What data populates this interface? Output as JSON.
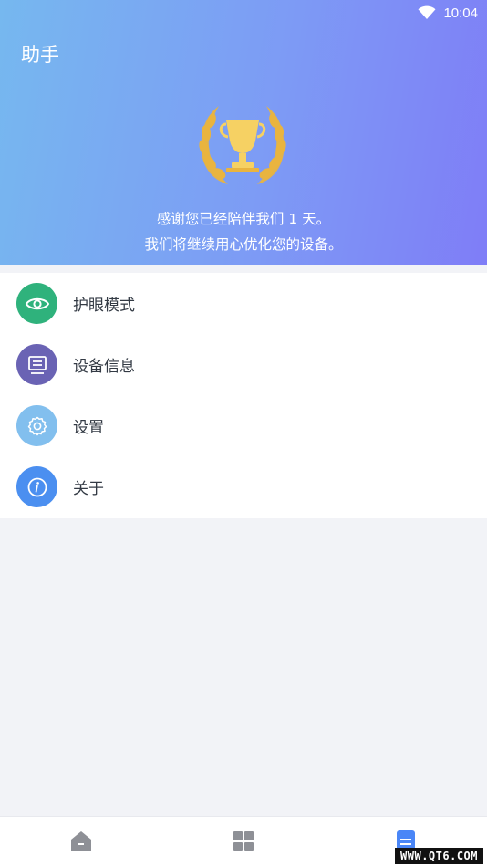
{
  "status_bar": {
    "time": "10:04",
    "wifi_icon": "wifi-icon"
  },
  "header": {
    "title": "助手",
    "trophy_icon": "trophy-laurel-icon",
    "message_line1": "感谢您已经陪伴我们 1 天。",
    "message_line2": "我们将继续用心优化您的设备。"
  },
  "menu": {
    "items": [
      {
        "label": "护眼模式",
        "icon": "eye-icon",
        "color": "#2fb27c"
      },
      {
        "label": "设备信息",
        "icon": "device-info-icon",
        "color": "#6a63b4"
      },
      {
        "label": "设置",
        "icon": "gear-icon",
        "color": "#82bfee"
      },
      {
        "label": "关于",
        "icon": "info-icon",
        "color": "#4b8ff0"
      }
    ]
  },
  "bottom_nav": {
    "items": [
      {
        "icon": "home-icon",
        "active": false
      },
      {
        "icon": "grid-icon",
        "active": false
      },
      {
        "icon": "document-icon",
        "active": true
      }
    ],
    "active_color": "#4a86f7",
    "inactive_color": "#8e9096"
  },
  "watermark": "WWW.QT6.COM"
}
